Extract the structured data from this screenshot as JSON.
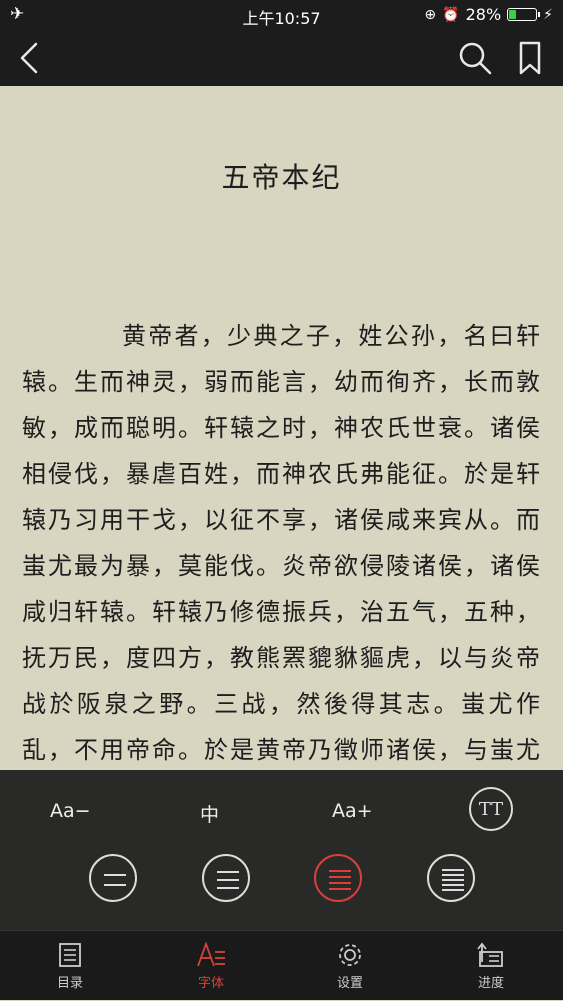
{
  "status_bar": {
    "time": "上午10:57",
    "battery": "28%",
    "battery_level": 0.28
  },
  "reader": {
    "chapter_title": "五帝本纪",
    "body": "黄帝者，少典之子，姓公孙，名曰轩辕。生而神灵，弱而能言，幼而徇齐，长而敦敏，成而聪明。轩辕之时，神农氏世衰。诸侯相侵伐，暴虐百姓，而神农氏弗能征。於是轩辕乃习用干戈，以征不享，诸侯咸来宾从。而蚩尤最为暴，莫能伐。炎帝欲侵陵诸侯，诸侯咸归轩辕。轩辕乃修德振兵，治五气，五种，抚万民，度四方，教熊罴貔貅貙虎，以与炎帝战於阪泉之野。三战，然後得其志。蚩尤作乱，不用帝命。於是黄帝乃徵师诸侯，与蚩尤"
  },
  "font_panel": {
    "decrease_label": "Aa−",
    "current_size": "中",
    "increase_label": "Aa+",
    "font_button": "TT"
  },
  "colors": {
    "accent": "#d9403c",
    "paper": "#d8d5c0",
    "bar": "#1c1c1c"
  },
  "tabs": [
    {
      "label": "目录",
      "icon": "toc-icon"
    },
    {
      "label": "字体",
      "icon": "font-icon"
    },
    {
      "label": "设置",
      "icon": "settings-icon"
    },
    {
      "label": "进度",
      "icon": "progress-icon"
    }
  ]
}
